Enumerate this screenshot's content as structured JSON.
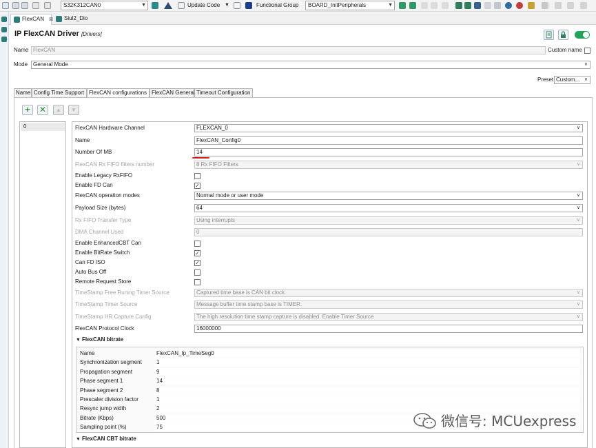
{
  "toolbar": {
    "project_combo": "S32K312CAN0",
    "update_code": "Update Code",
    "functional_group": "Functional Group",
    "group_combo": "BOARD_InitPeripherals"
  },
  "editor_tabs": [
    {
      "label": "FlexCAN",
      "close": "⊠"
    },
    {
      "label": "Siul2_Dio"
    }
  ],
  "header": {
    "title": "IP FlexCAN Driver",
    "subtitle": "[Drivers]",
    "name_label": "Name",
    "name_value": "FlexCAN",
    "custom_name_label": "Custom name",
    "mode_label": "Mode",
    "mode_value": "General Mode",
    "preset_label": "Preset",
    "preset_value": "Custom..."
  },
  "config_tabs": [
    {
      "label": "Name"
    },
    {
      "label": "Config Time Support"
    },
    {
      "label": "FlexCAN configurations"
    },
    {
      "label": "FlexCAN General"
    },
    {
      "label": "Timeout Configuration"
    }
  ],
  "list": {
    "items": [
      "0"
    ]
  },
  "properties": [
    {
      "label": "FlexCAN Hardware Channel",
      "type": "select",
      "value": "FLEXCAN_0",
      "disabled": false
    },
    {
      "label": "Name",
      "type": "text",
      "value": "FlexCAN_Config0",
      "disabled": false
    },
    {
      "label": "Number Of MB",
      "type": "text",
      "value": "14",
      "disabled": false
    },
    {
      "label": "FlexCAN Rx FIFO filters number",
      "type": "select",
      "value": "8 Rx FIFO Filters",
      "disabled": true
    },
    {
      "label": "Enable Legacy RxFIFO",
      "type": "check",
      "checked": false
    },
    {
      "label": "Enable FD Can",
      "type": "check",
      "checked": true
    },
    {
      "label": "FlexCAN operation modes",
      "type": "select",
      "value": "Normal mode or user mode",
      "disabled": false
    },
    {
      "label": "Payload Size (bytes)",
      "type": "select",
      "value": "64",
      "disabled": false
    },
    {
      "label": "Rx FIFO Transfer Type",
      "type": "select",
      "value": "Using interrupts",
      "disabled": true
    },
    {
      "label": "DMA Channel Used",
      "type": "text",
      "value": "0",
      "disabled": true
    },
    {
      "label": "Enable EnhancedCBT Can",
      "type": "check",
      "checked": false
    },
    {
      "label": "Enable BitRate Switch",
      "type": "check",
      "checked": true
    },
    {
      "label": "Can FD ISO",
      "type": "check",
      "checked": true
    },
    {
      "label": "Auto Bus Off",
      "type": "check",
      "checked": false
    },
    {
      "label": "Remote Request Store",
      "type": "check",
      "checked": false
    },
    {
      "label": "TimeStamp Free Runing Timer Source",
      "type": "select",
      "value": "Captured time base is CAN bit clock.",
      "disabled": true
    },
    {
      "label": "TimeStamp Timer Source",
      "type": "select",
      "value": "Message buffer time stamp base is TIMER.",
      "disabled": true
    },
    {
      "label": "TimeStamp HR Capture Config",
      "type": "select",
      "value": "The high resolution time stamp capture is disabled. Enable Timer Source",
      "disabled": true
    },
    {
      "label": "FlexCAN Protocol Clock",
      "type": "text",
      "value": "16000000",
      "disabled": false
    }
  ],
  "bitrate_section": {
    "title": "FlexCAN bitrate",
    "rows": [
      {
        "label": "Name",
        "value": "FlexCAN_Ip_TimeSeg0"
      },
      {
        "label": "Synchronization segment",
        "value": "1"
      },
      {
        "label": "Propagation segment",
        "value": "9"
      },
      {
        "label": "Phase segment 1",
        "value": "14"
      },
      {
        "label": "Phase segment 2",
        "value": "8"
      },
      {
        "label": "Prescaler division factor",
        "value": "1"
      },
      {
        "label": "Resync jump width",
        "value": "2"
      },
      {
        "label": "Bitrate (Kbps)",
        "value": "500"
      },
      {
        "label": "Sampling point (%)",
        "value": "75"
      }
    ]
  },
  "cbt_section": {
    "title": "FlexCAN CBT bitrate"
  },
  "watermark": {
    "text": "微信号: MCUexpress"
  },
  "colors": {
    "accent_green": "#21a35a",
    "highlight_red": "#d81d1d"
  }
}
